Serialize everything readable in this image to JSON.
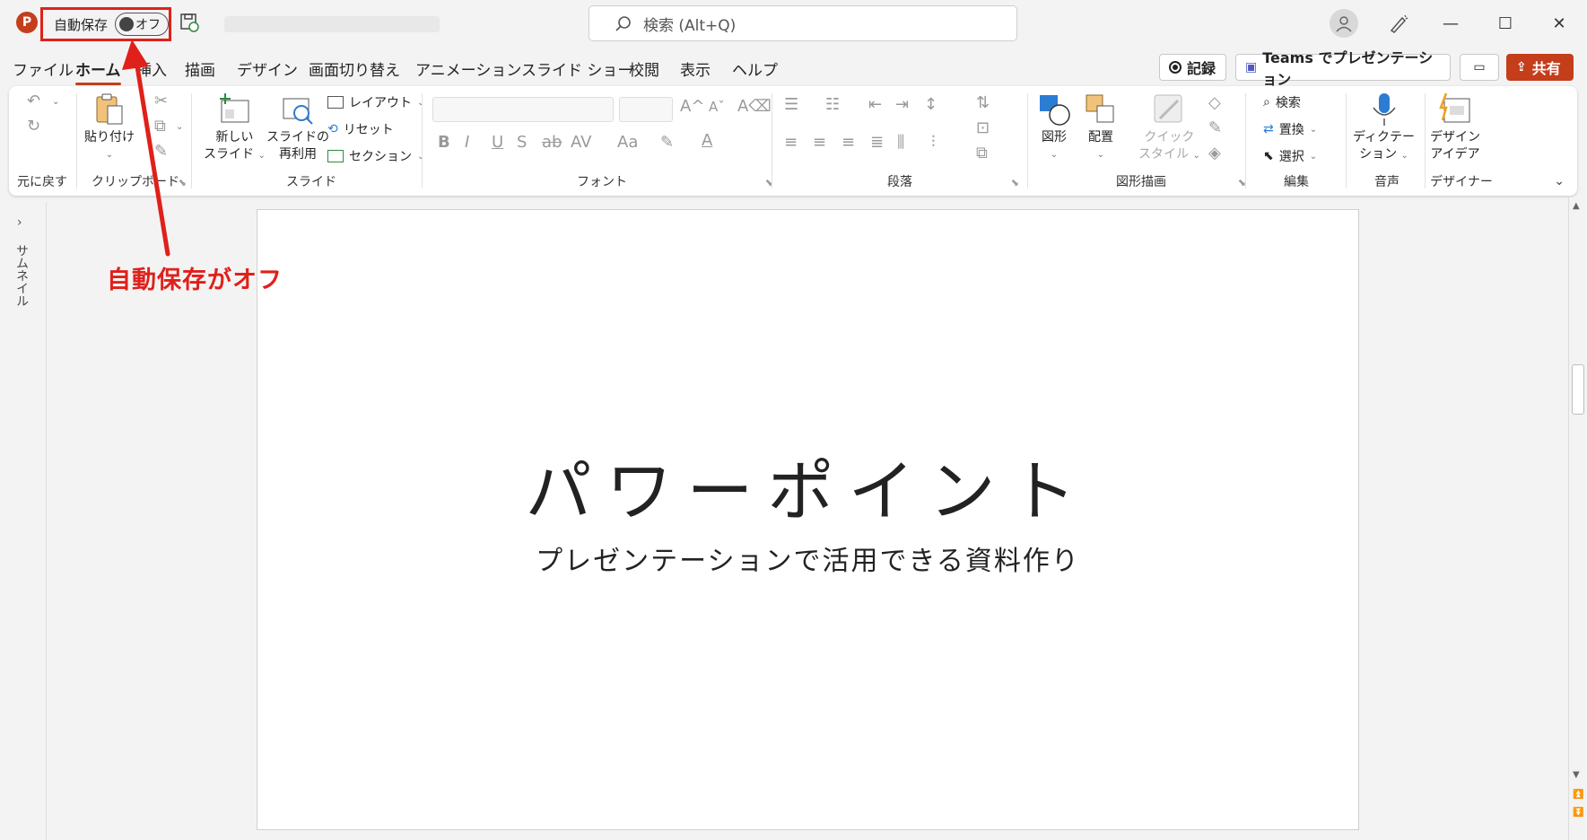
{
  "titlebar": {
    "app_icon_letter": "P",
    "autosave_label": "自動保存",
    "autosave_state": "オフ",
    "search_placeholder": "検索 (Alt+Q)"
  },
  "menu": {
    "tabs": [
      "ファイル",
      "ホーム",
      "挿入",
      "描画",
      "デザイン",
      "画面切り替え",
      "アニメーション",
      "スライド ショー",
      "校閲",
      "表示",
      "ヘルプ"
    ],
    "active_tab": "ホーム",
    "record_label": "記録",
    "teams_label": "Teams でプレゼンテーション",
    "share_label": "共有"
  },
  "ribbon": {
    "undo_group": "元に戻す",
    "clipboard_group": "クリップボード",
    "paste_label": "貼り付け",
    "slides_group": "スライド",
    "new_slide_label": [
      "新しい",
      "スライド"
    ],
    "reuse_slide_label": [
      "スライドの",
      "再利用"
    ],
    "layout_label": "レイアウト",
    "reset_label": "リセット",
    "section_label": "セクション",
    "font_group": "フォント",
    "paragraph_group": "段落",
    "drawing_group": "図形描画",
    "shape_label": "図形",
    "arrange_label": "配置",
    "quick_style_label": [
      "クイック",
      "スタイル"
    ],
    "editing_group": "編集",
    "find_label": "検索",
    "replace_label": "置換",
    "select_label": "選択",
    "voice_group": "音声",
    "dictate_label": [
      "ディクテー",
      "ション"
    ],
    "designer_group": "デザイナー",
    "design_ideas_label": [
      "デザイン",
      "アイデア"
    ]
  },
  "thumbnail_panel": {
    "label": "サムネイル"
  },
  "slide": {
    "title": "パワーポイント",
    "subtitle": "プレゼンテーションで活用できる資料作り"
  },
  "annotation": {
    "text": "自動保存がオフ",
    "color": "#e0201a"
  },
  "colors": {
    "accent": "#c43e1c"
  }
}
